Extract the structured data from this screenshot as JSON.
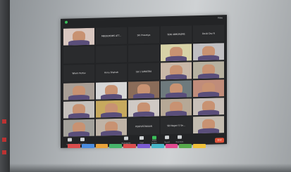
{
  "scene": {
    "title": "",
    "topbar": {
      "view_label": "View"
    },
    "tiles": [
      {
        "name": "",
        "kind": "person",
        "bg": "#d9c7c0"
      },
      {
        "name": "M8E9OFDMS ATT...",
        "kind": "name"
      },
      {
        "name": "Siti Prasetya",
        "kind": "name"
      },
      {
        "name": "SDN 48MOROMS",
        "kind": "name"
      },
      {
        "name": "Dwiki Dwi R",
        "kind": "name"
      },
      {
        "name": "",
        "kind": "name"
      },
      {
        "name": "",
        "kind": "name"
      },
      {
        "name": "",
        "kind": "name"
      },
      {
        "name": "",
        "kind": "person",
        "bg": "#d7d2a7"
      },
      {
        "name": "",
        "kind": "person",
        "bg": "#c0bfc2"
      },
      {
        "name": "Wiwin Pertiw",
        "kind": "name"
      },
      {
        "name": "Annu Shahab",
        "kind": "name"
      },
      {
        "name": "SD 1 SUMATRA",
        "kind": "name"
      },
      {
        "name": "",
        "kind": "person",
        "bg": "#c9b8a8"
      },
      {
        "name": "",
        "kind": "person",
        "bg": "#b7b1a0"
      },
      {
        "name": "",
        "kind": "person",
        "bg": "#a99f96"
      },
      {
        "name": "",
        "kind": "person",
        "bg": "#d6d6d6"
      },
      {
        "name": "",
        "kind": "person",
        "bg": "#8a6c59"
      },
      {
        "name": "",
        "kind": "person",
        "bg": "#6e7a7d"
      },
      {
        "name": "",
        "kind": "person",
        "bg": "#c08c7a"
      },
      {
        "name": "",
        "kind": "person",
        "bg": "#c4c0bb"
      },
      {
        "name": "",
        "kind": "person",
        "bg": "#c7a95e"
      },
      {
        "name": "",
        "kind": "person",
        "bg": "#cfc9c4"
      },
      {
        "name": "",
        "kind": "person",
        "bg": "#b6a896"
      },
      {
        "name": "",
        "kind": "person",
        "bg": "#c8bfb8"
      },
      {
        "name": "",
        "kind": "person",
        "bg": "#a3a19b"
      },
      {
        "name": "",
        "kind": "person",
        "bg": "#bfb3a6"
      },
      {
        "name": "PERPUSTAKAAN",
        "kind": "name"
      },
      {
        "name": "SD Negeri S Se...",
        "kind": "name"
      },
      {
        "name": "",
        "kind": "person",
        "bg": "#c3bcb0"
      }
    ],
    "controls": [
      {
        "label": "Unmute",
        "icon": "mic-icon"
      },
      {
        "label": "Start Video",
        "icon": "video-icon"
      },
      {
        "label": "Participants",
        "icon": "participants-icon"
      },
      {
        "label": "Chat",
        "icon": "chat-icon"
      },
      {
        "label": "Share Screen",
        "icon": "share-screen-icon"
      },
      {
        "label": "Record",
        "icon": "record-icon"
      },
      {
        "label": "Reactions",
        "icon": "reactions-icon"
      }
    ],
    "end_label": "End",
    "colors": {
      "accent_green": "#3bbf5a",
      "end_red": "#e0533a"
    },
    "taskbar_colors": [
      "#d94d4d",
      "#4b8de0",
      "#e9a23b",
      "#46b36a",
      "#d94d4d",
      "#7a5bd1",
      "#49b6c8",
      "#e04a8f",
      "#56a94b",
      "#f0c23a"
    ]
  }
}
